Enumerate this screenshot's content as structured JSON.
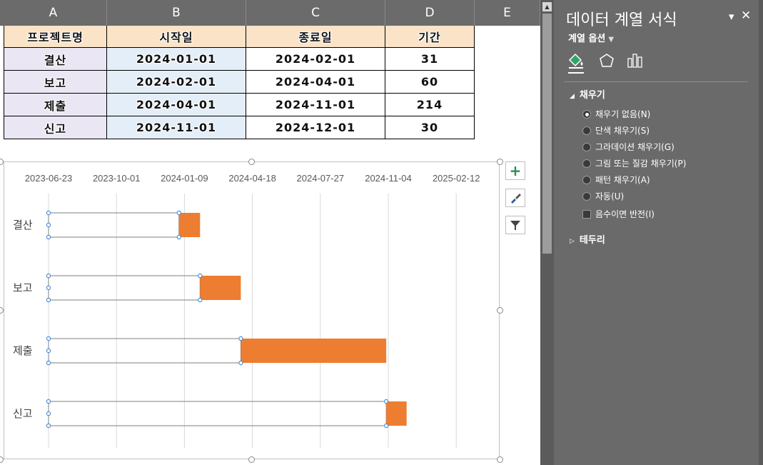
{
  "columns": [
    "A",
    "B",
    "C",
    "D",
    "E"
  ],
  "table": {
    "headers": [
      "프로젝트명",
      "시작일",
      "종료일",
      "기간"
    ],
    "rows": [
      [
        "결산",
        "2024-01-01",
        "2024-02-01",
        "31"
      ],
      [
        "보고",
        "2024-02-01",
        "2024-04-01",
        "60"
      ],
      [
        "제출",
        "2024-04-01",
        "2024-11-01",
        "214"
      ],
      [
        "신고",
        "2024-11-01",
        "2024-12-01",
        "30"
      ]
    ]
  },
  "chart_data": {
    "type": "bar",
    "orientation": "horizontal-stacked",
    "categories": [
      "결산",
      "보고",
      "제출",
      "신고"
    ],
    "series": [
      {
        "values": [
          "2024-01-01",
          "2024-02-01",
          "2024-04-01",
          "2024-11-01"
        ],
        "fill": "none"
      },
      {
        "values": [
          31,
          60,
          214,
          30
        ],
        "color": "#ed7d31"
      }
    ],
    "x_axis": {
      "position": "top",
      "tick_labels": [
        "2023-06-23",
        "2023-10-01",
        "2024-01-09",
        "2024-04-18",
        "2024-07-27",
        "2024-11-04",
        "2025-02-12"
      ],
      "min": "2023-06-23",
      "max": "2025-05-23"
    },
    "grid": true,
    "selected_series": 0
  },
  "chart_buttons": [
    {
      "icon": "plus-icon",
      "symbol": "+"
    },
    {
      "icon": "brush-icon",
      "symbol": "✎"
    },
    {
      "icon": "filter-icon",
      "symbol": "▼"
    }
  ],
  "pane": {
    "title": "데이터 계열 서식",
    "subtitle": "계열 옵션",
    "fill_section": "채우기",
    "options": [
      {
        "label": "채우기 없음(N)",
        "selected": true
      },
      {
        "label": "단색 채우기(S)",
        "selected": false
      },
      {
        "label": "그라데이션 채우기(G)",
        "selected": false
      },
      {
        "label": "그림 또는 질감 채우기(P)",
        "selected": false
      },
      {
        "label": "패턴 채우기(A)",
        "selected": false
      },
      {
        "label": "자동(U)",
        "selected": false
      }
    ],
    "invert_label": "음수이면 반전(I)",
    "border_section": "테두리"
  },
  "colors": {
    "accent": "#ed7d31",
    "pane_bg": "#6a6a6a",
    "header_bg": "#6b6b6b"
  }
}
